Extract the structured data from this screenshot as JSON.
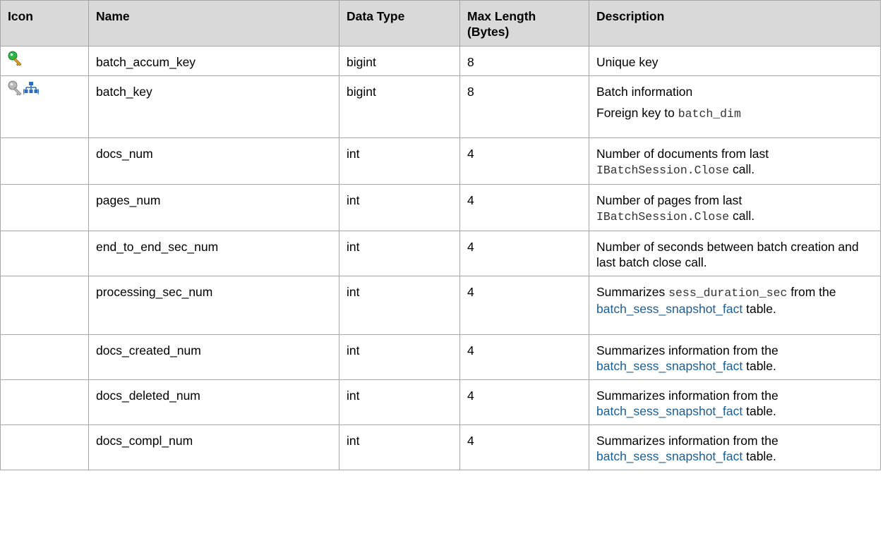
{
  "headers": {
    "icon": "Icon",
    "name": "Name",
    "data_type": "Data Type",
    "max_length_line1": "Max Length",
    "max_length_line2": "(Bytes)",
    "description": "Description"
  },
  "icon_colors": {
    "primary_key_head": "#2bb64a",
    "primary_key_shaft": "#d8a623",
    "foreign_key_head": "#a8a8a8",
    "hierarchy": "#2a6fbd"
  },
  "rows": [
    {
      "icon": "primary-key-icon",
      "name": "batch_accum_key",
      "data_type": "bigint",
      "max_length": "8",
      "desc": {
        "text": "Unique key"
      }
    },
    {
      "icon": "foreign-key-icon",
      "name": "batch_key",
      "data_type": "bigint",
      "max_length": "8",
      "desc": {
        "line1": "Batch information",
        "line2_pre": "Foreign key to ",
        "line2_code": "batch_dim"
      }
    },
    {
      "icon": "",
      "name": "docs_num",
      "data_type": "int",
      "max_length": "4",
      "desc": {
        "pre": "Number of documents from last ",
        "code": "IBatchSession.Close",
        "post": " call."
      }
    },
    {
      "icon": "",
      "name": "pages_num",
      "data_type": "int",
      "max_length": "4",
      "desc": {
        "pre": "Number of pages from last ",
        "code": "IBatchSession.Close",
        "post": " call."
      }
    },
    {
      "icon": "",
      "name": "end_to_end_sec_num",
      "data_type": "int",
      "max_length": "4",
      "desc": {
        "text": "Number of seconds between batch creation and last batch close call."
      }
    },
    {
      "icon": "",
      "name": "processing_sec_num",
      "data_type": "int",
      "max_length": "4",
      "desc": {
        "pre": "Summarizes ",
        "code": "sess_duration_sec",
        "mid": " from the ",
        "link": "batch_sess_snapshot_fact",
        "post": " table."
      }
    },
    {
      "icon": "",
      "name": "docs_created_num",
      "data_type": "int",
      "max_length": "4",
      "desc": {
        "pre": "Summarizes information from the ",
        "link": "batch_sess_snapshot_fact",
        "post": " table."
      }
    },
    {
      "icon": "",
      "name": "docs_deleted_num",
      "data_type": "int",
      "max_length": "4",
      "desc": {
        "pre": "Summarizes information from the ",
        "link": "batch_sess_snapshot_fact",
        "post": " table."
      }
    },
    {
      "icon": "",
      "name": "docs_compl_num",
      "data_type": "int",
      "max_length": "4",
      "desc": {
        "pre": "Summarizes information from the ",
        "link": "batch_sess_snapshot_fact",
        "post": " table."
      }
    }
  ]
}
